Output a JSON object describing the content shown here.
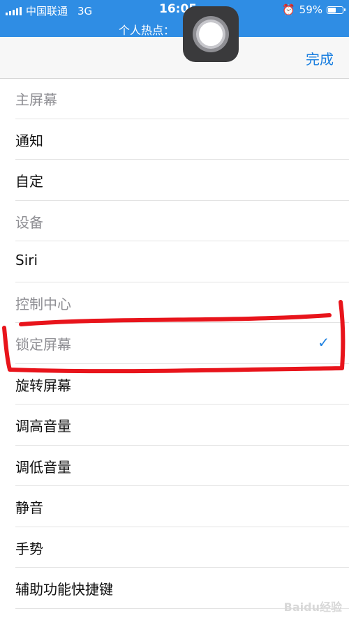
{
  "status_bar": {
    "carrier": "中国联通",
    "network": "3G",
    "time": "16:05",
    "battery": "59%",
    "battery_level": 0.59,
    "hotspot": "个人热点："
  },
  "navbar": {
    "done_label": "完成"
  },
  "list": {
    "items": [
      {
        "label": "主屏幕",
        "enabled": false,
        "selected": false
      },
      {
        "label": "通知",
        "enabled": true,
        "selected": false
      },
      {
        "label": "自定",
        "enabled": true,
        "selected": false
      },
      {
        "label": "设备",
        "enabled": false,
        "selected": false
      },
      {
        "label": "Siri",
        "enabled": true,
        "selected": false
      },
      {
        "label": "控制中心",
        "enabled": false,
        "selected": false
      },
      {
        "label": "锁定屏幕",
        "enabled": false,
        "selected": true
      },
      {
        "label": "旋转屏幕",
        "enabled": true,
        "selected": false
      },
      {
        "label": "调高音量",
        "enabled": true,
        "selected": false
      },
      {
        "label": "调低音量",
        "enabled": true,
        "selected": false
      },
      {
        "label": "静音",
        "enabled": true,
        "selected": false
      },
      {
        "label": "手势",
        "enabled": true,
        "selected": false
      },
      {
        "label": "辅助功能快捷键",
        "enabled": true,
        "selected": false
      }
    ],
    "check_glyph": "✓"
  },
  "colors": {
    "accent": "#1b7fe0",
    "status_bar": "#2f8de4",
    "annotation": "#e8141b"
  },
  "icons": {
    "assistive_touch": "assistive-touch-icon",
    "checkmark": "checkmark-icon"
  },
  "watermark": "Baidu经验"
}
